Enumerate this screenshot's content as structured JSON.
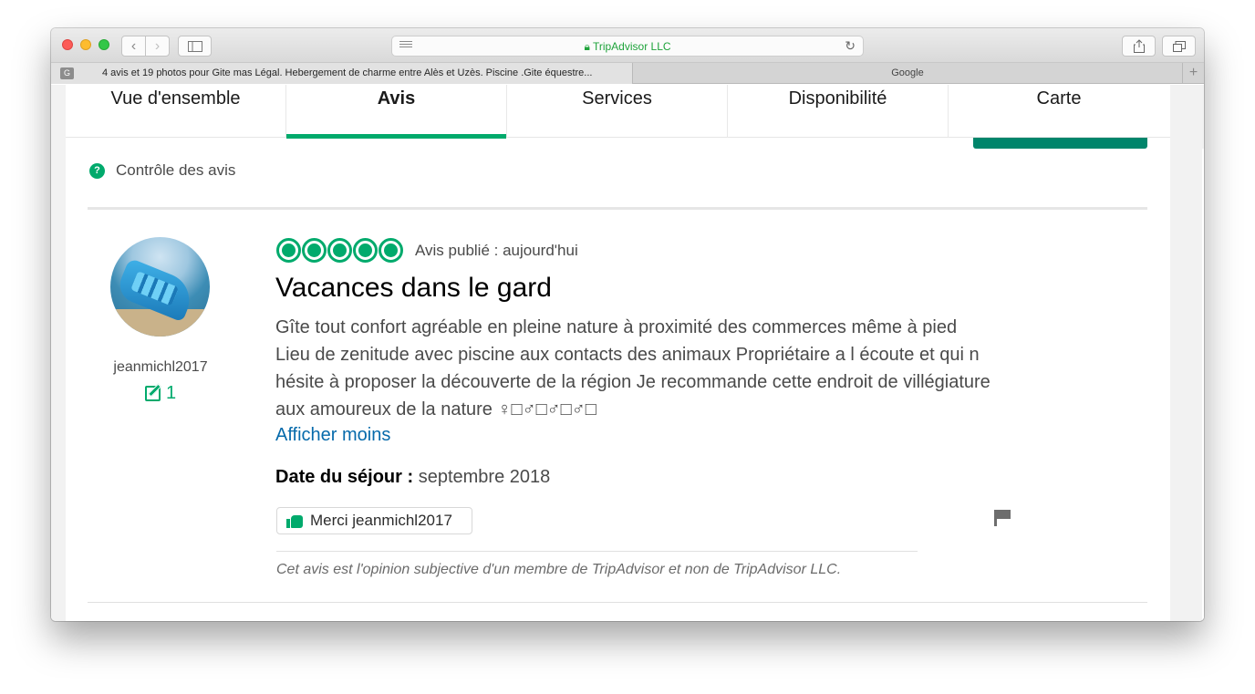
{
  "browser": {
    "address_text": "TripAdvisor LLC",
    "tabs": [
      {
        "favicon_letter": "G",
        "title": "4 avis et 19 photos pour Gite mas Légal. Hebergement de charme entre Alès et Uzès. Piscine .Gite équestre..."
      },
      {
        "title": "Google"
      }
    ]
  },
  "nav_tabs": [
    {
      "label": "Vue d'ensemble"
    },
    {
      "label": "Avis"
    },
    {
      "label": "Services"
    },
    {
      "label": "Disponibilité"
    },
    {
      "label": "Carte"
    }
  ],
  "active_tab": "Avis",
  "control_label": "Contrôle des avis",
  "review": {
    "username": "jeanmichl2017",
    "contributions": "1",
    "rating": 5,
    "published": "Avis publié : aujourd'hui",
    "title": "Vacances dans le gard",
    "body_lines": [
      "Gîte tout confort agréable en pleine nature à proximité des commerces même à pied",
      "Lieu de zenitude avec piscine aux contacts des animaux Propriétaire a l écoute et qui n",
      "hésite à proposer la découverte de la région Je recommande cette endroit de villégiature",
      "aux amoureux de la nature ♀□♂□♂□♂□"
    ],
    "less_link": "Afficher moins",
    "stay_label": "Date du séjour :",
    "stay_value": " septembre 2018",
    "thanks_label": "Merci jeanmichl2017",
    "disclaimer": "Cet avis est l'opinion subjective d'un membre de TripAdvisor et non de TripAdvisor LLC."
  },
  "colors": {
    "accent": "#00aa6c",
    "link": "#066aab",
    "button_dark": "#00856b"
  }
}
